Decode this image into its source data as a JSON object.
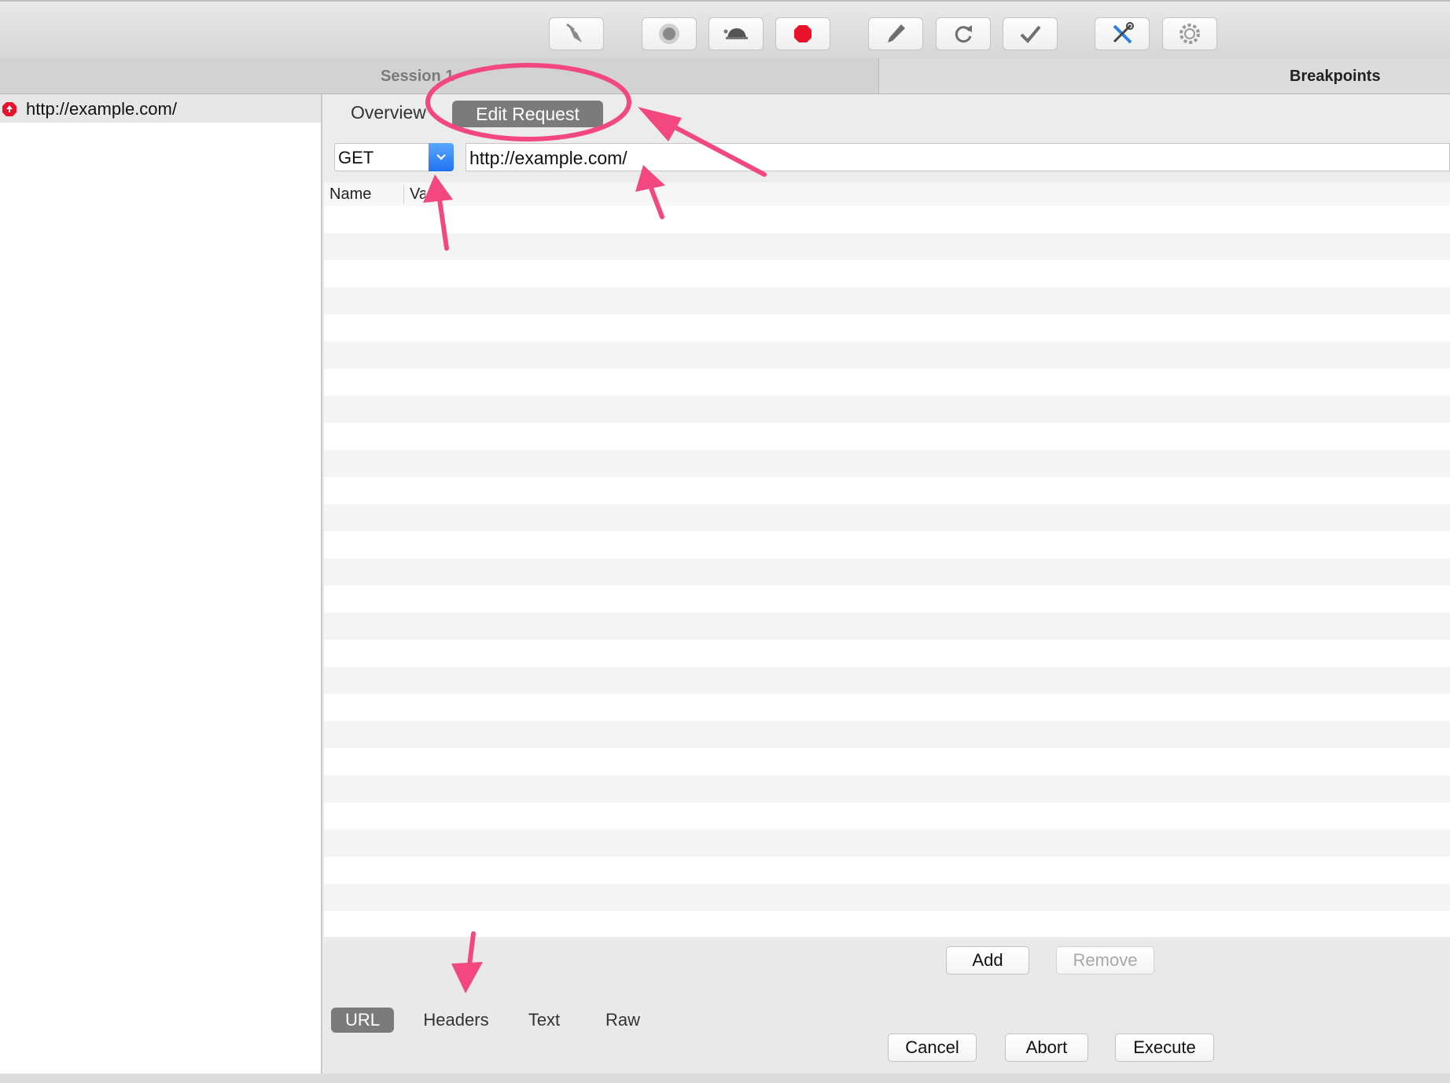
{
  "toolbar": {
    "buttons": [
      {
        "name": "broom-icon"
      },
      {
        "name": "record-icon"
      },
      {
        "name": "turtle-icon"
      },
      {
        "name": "stop-icon"
      },
      {
        "name": "pen-icon"
      },
      {
        "name": "repeat-icon"
      },
      {
        "name": "checkmark-icon"
      },
      {
        "name": "tools-icon"
      },
      {
        "name": "gear-icon"
      }
    ]
  },
  "session": {
    "title": "Session 1"
  },
  "breakpoints": {
    "title": "Breakpoints"
  },
  "sidebar": {
    "items": [
      {
        "label": "http://example.com/"
      }
    ]
  },
  "tabs": {
    "overview": "Overview",
    "edit_request": "Edit Request"
  },
  "request": {
    "method": "GET",
    "url": "http://example.com/"
  },
  "table": {
    "columns": [
      "Name",
      "Va"
    ]
  },
  "actions": {
    "add": "Add",
    "remove": "Remove"
  },
  "views": {
    "url": "URL",
    "headers": "Headers",
    "text": "Text",
    "raw": "Raw"
  },
  "footer": {
    "cancel": "Cancel",
    "abort": "Abort",
    "execute": "Execute"
  },
  "colors": {
    "accent": "#1f73f0",
    "annotation": "#f2477f",
    "stop": "#e8132a"
  }
}
